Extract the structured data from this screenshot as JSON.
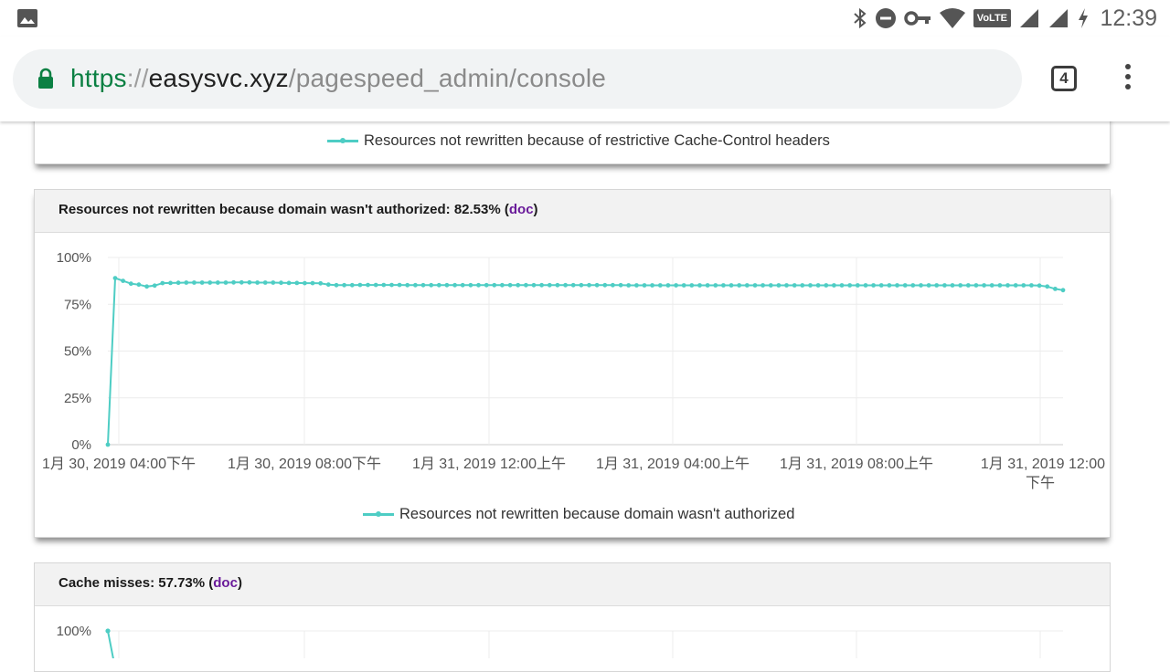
{
  "status_bar": {
    "time": "12:39",
    "icons": [
      "photo-icon",
      "bluetooth-icon",
      "do-not-disturb-icon",
      "vpn-key-icon",
      "wifi-icon",
      "volte-icon",
      "signal-icon",
      "signal-icon",
      "charging-icon"
    ],
    "volte_label": "VoLTE"
  },
  "browser": {
    "url_scheme": "https",
    "url_sep": "://",
    "url_host": "easysvc.xyz",
    "url_path": "/pagespeed_admin/console",
    "tab_count": "4"
  },
  "colors": {
    "series": "#4ecdc4",
    "doc_link": "#6a1b9a",
    "url_scheme": "#0b8043"
  },
  "cards": {
    "cache_control": {
      "legend": "Resources not rewritten because of restrictive Cache-Control headers"
    },
    "domain": {
      "title_prefix": "Resources not rewritten because domain wasn't authorized: 82.53% (",
      "doc": "doc",
      "title_suffix": ")",
      "legend": "Resources not rewritten because domain wasn't authorized"
    },
    "cache_misses": {
      "title_prefix": "Cache misses: 57.73% (",
      "doc": "doc",
      "title_suffix": ")",
      "y_tick_top": "100%"
    }
  },
  "chart_data": [
    {
      "type": "line",
      "title": "Resources not rewritten because domain wasn't authorized: 82.53%",
      "y_ticks": [
        "0%",
        "25%",
        "50%",
        "75%",
        "100%"
      ],
      "ylim": [
        0,
        100
      ],
      "x_ticks": [
        "1月 30, 2019 04:00下午",
        "1月 30, 2019 08:00下午",
        "1月 31, 2019 12:00上午",
        "1月 31, 2019 04:00上午",
        "1月 31, 2019 08:00上午",
        "1月 31, 2019 12:00 下午"
      ],
      "grid": true,
      "legend_position": "bottom",
      "series": [
        {
          "name": "Resources not rewritten because domain wasn't authorized",
          "values": [
            0,
            89,
            87.5,
            86,
            85.5,
            84.5,
            85,
            86.3,
            86.4,
            86.5,
            86.6,
            86.6,
            86.6,
            86.6,
            86.6,
            86.6,
            86.7,
            86.7,
            86.7,
            86.6,
            86.6,
            86.6,
            86.5,
            86.4,
            86.4,
            86.3,
            86.3,
            86.2,
            85.5,
            85.2,
            85.2,
            85.2,
            85.3,
            85.3,
            85.3,
            85.3,
            85.3,
            85.3,
            85.2,
            85.2,
            85.2,
            85.2,
            85.2,
            85.2,
            85.2,
            85.2,
            85.2,
            85.2,
            85.2,
            85.2,
            85.2,
            85.2,
            85.2,
            85.2,
            85.2,
            85.2,
            85.2,
            85.2,
            85.2,
            85.2,
            85.2,
            85.2,
            85.2,
            85.2,
            85.2,
            85.2,
            85.1,
            85.1,
            85.1,
            85.1,
            85.1,
            85.1,
            85.1,
            85.1,
            85.1,
            85.1,
            85.1,
            85.1,
            85.1,
            85.1,
            85.1,
            85.1,
            85.1,
            85.1,
            85.1,
            85.1,
            85.1,
            85.1,
            85.1,
            85.1,
            85.1,
            85.1,
            85.1,
            85.1,
            85.1,
            85.1,
            85.1,
            85.1,
            85.1,
            85.1,
            85.1,
            85.1,
            85.1,
            85.1,
            85.1,
            85.1,
            85.1,
            85.1,
            85.1,
            85.1,
            85.1,
            85.1,
            85.1,
            85.1,
            85.1,
            85.1,
            85.1,
            85.1,
            85.0,
            84.5,
            83.2,
            82.53
          ]
        }
      ]
    },
    {
      "type": "line",
      "title": "Cache misses: 57.73%",
      "y_ticks": [
        "100%"
      ],
      "ylim": [
        0,
        100
      ],
      "series": [
        {
          "values": [
            100,
            85
          ]
        }
      ]
    }
  ]
}
